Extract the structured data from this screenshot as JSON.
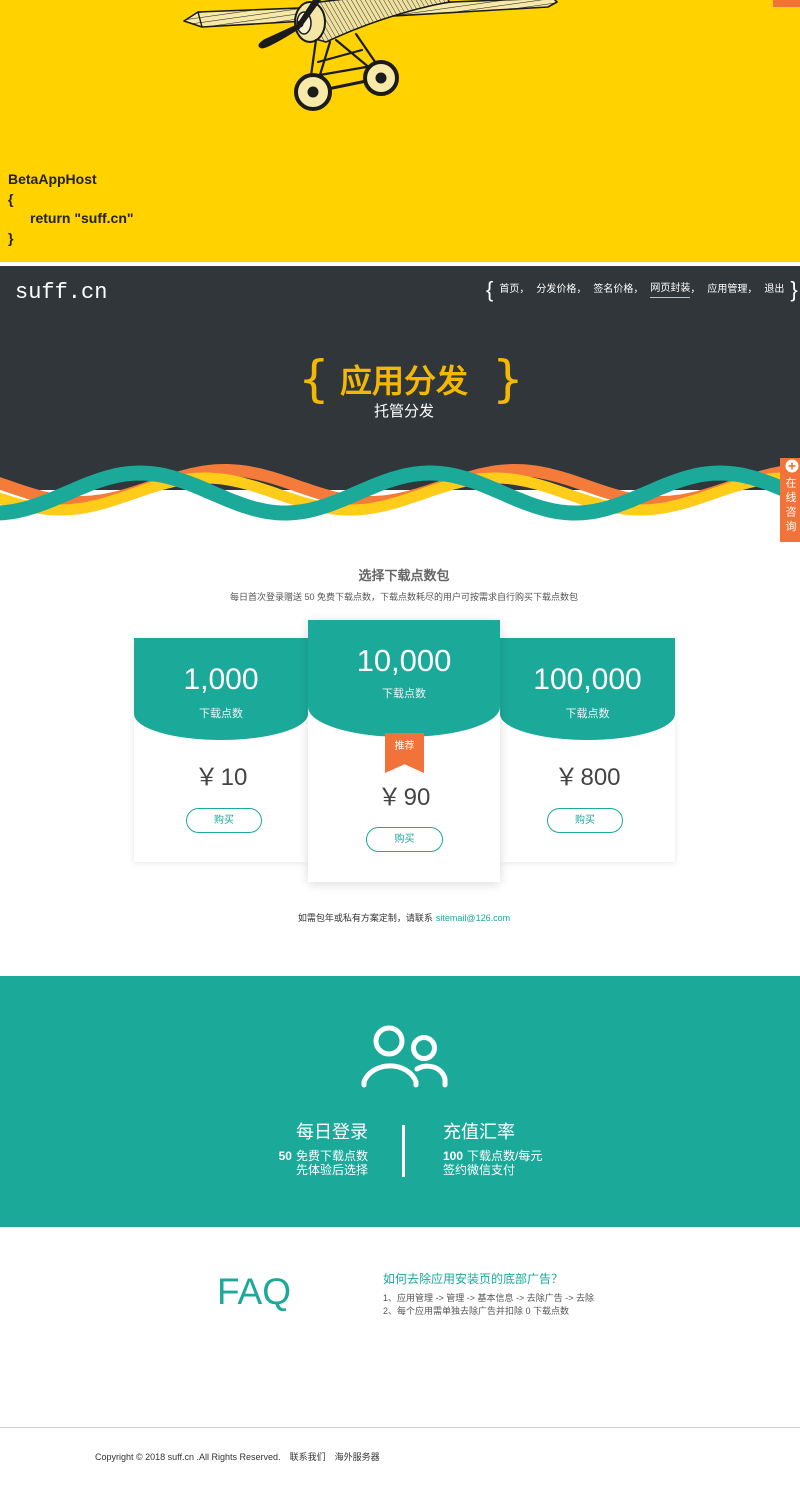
{
  "colors": {
    "yellow": "#ffd200",
    "dark": "#30363a",
    "teal": "#1ba99a",
    "orange": "#f2733a",
    "gold": "#f5b800"
  },
  "hero": {
    "illustration": "airplane-illustration",
    "code": {
      "line1": "BetaAppHost",
      "open": "{",
      "statement": "return \"suff.cn\"",
      "close": "}"
    }
  },
  "header": {
    "logo": "suff.cn",
    "brace_open": "{",
    "brace_close": "}",
    "nav_separator": "，",
    "nav": [
      {
        "label": "首页"
      },
      {
        "label": "分发价格"
      },
      {
        "label": "签名价格"
      },
      {
        "label": "网页封装",
        "active": true
      },
      {
        "label": "应用管理"
      },
      {
        "label": "退出"
      }
    ],
    "title": "应用分发",
    "subtitle": "托管分发"
  },
  "side_tab": {
    "icon": "plus-circle-icon",
    "label": "在线咨询"
  },
  "pricing": {
    "heading": "选择下载点数包",
    "description": "每日首次登录赠送 50 免费下载点数，下载点数耗尽的用户可按需求自行购买下载点数包",
    "currency": "￥",
    "plans": [
      {
        "points": "1,000",
        "unit": "下载点数",
        "price": "10",
        "button": "购买"
      },
      {
        "points": "10,000",
        "unit": "下载点数",
        "price": "90",
        "button": "购买",
        "badge": "推荐"
      },
      {
        "points": "100,000",
        "unit": "下载点数",
        "price": "800",
        "button": "购买"
      }
    ],
    "contact_text": "如需包年或私有方案定制，请联系",
    "contact_email": "sitemail@126.com"
  },
  "features": {
    "icon": "users-icon",
    "left": {
      "title": "每日登录",
      "highlight": {
        "count": "50",
        "text": "免费下载点数"
      },
      "note": "先体验后选择"
    },
    "right": {
      "title": "充值汇率",
      "highlight": {
        "count": "100",
        "text": "下载点数/每元"
      },
      "note": "签约微信支付"
    }
  },
  "faq": {
    "label": "FAQ",
    "question": "如何去除应用安装页的底部广告？",
    "answers": [
      "1、应用管理 -> 管理 -> 基本信息 -> 去除广告 -> 去除",
      "2、每个应用需单独去除广告并扣除 0 下载点数"
    ]
  },
  "footer": {
    "copyright": "Copyright © 2018 suff.cn .All Rights Reserved.",
    "links": [
      "联系我们",
      "海外服务器"
    ]
  }
}
